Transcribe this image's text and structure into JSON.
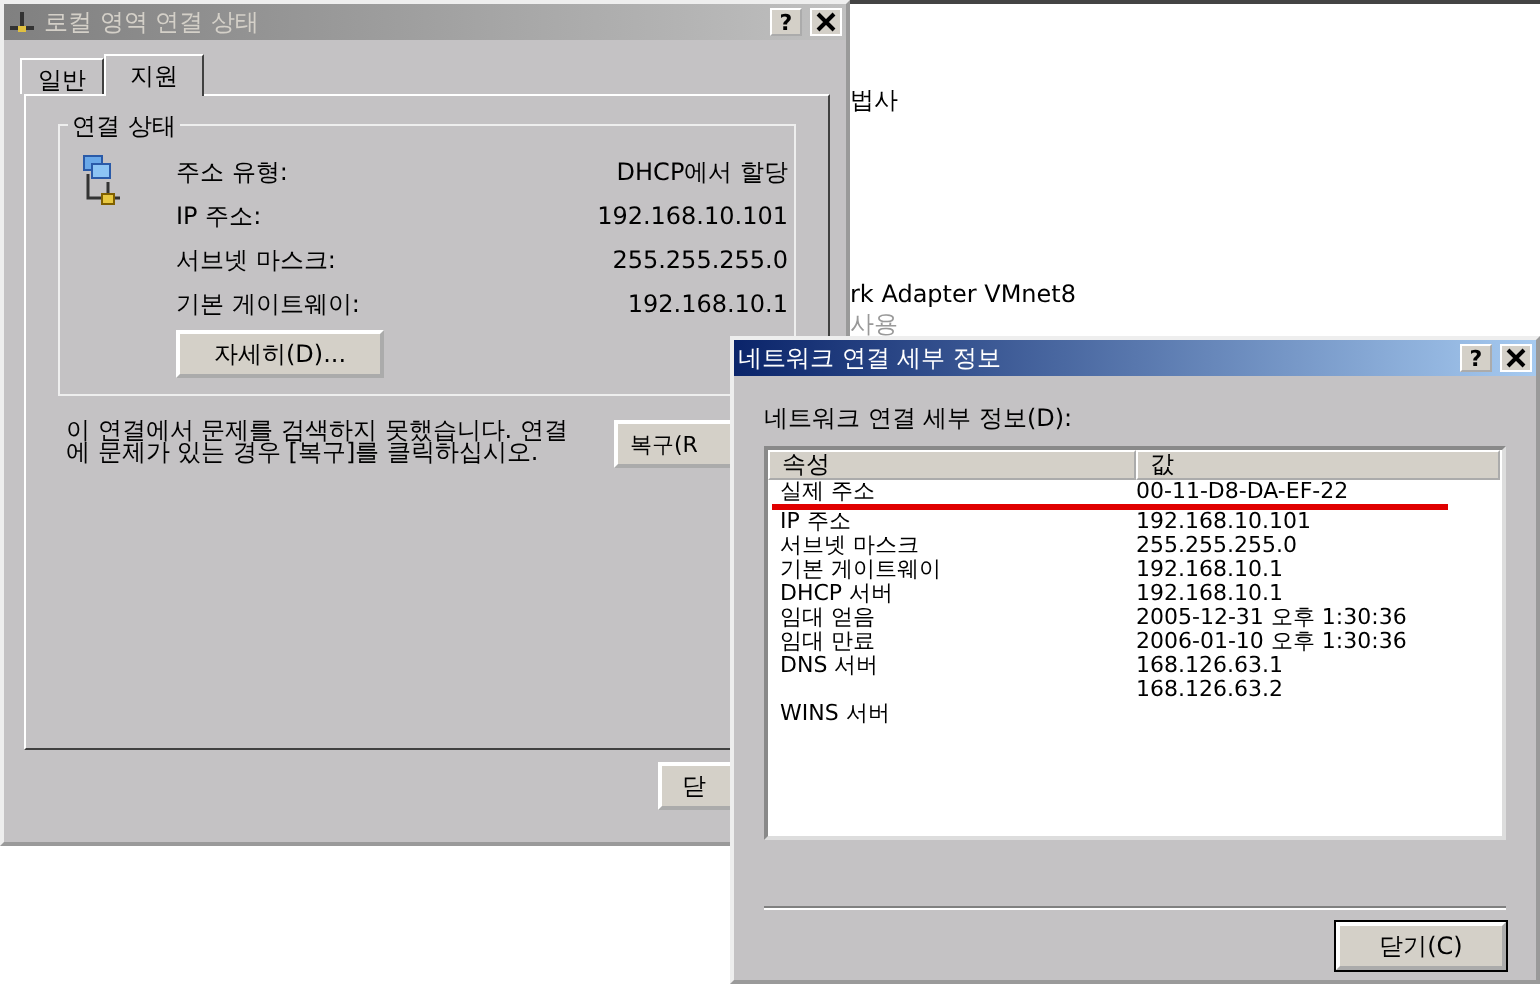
{
  "background_window": {
    "texts": [
      {
        "text": "법사",
        "disabled": false
      },
      {
        "text": "rk Adapter VMnet8",
        "disabled": false
      },
      {
        "text": "사용",
        "disabled": true
      }
    ]
  },
  "status_window": {
    "title": "로컬 영역 연결 상태",
    "active": false,
    "help_button": "?",
    "tabs": [
      {
        "label": "일반",
        "selected": false
      },
      {
        "label": "지원",
        "selected": true
      }
    ],
    "group_title": "연결 상태",
    "fields": [
      {
        "label": "주소 유형:",
        "value": "DHCP에서 할당"
      },
      {
        "label": "IP 주소:",
        "value": "192.168.10.101"
      },
      {
        "label": "서브넷 마스크:",
        "value": "255.255.255.0"
      },
      {
        "label": "기본 게이트웨이:",
        "value": "192.168.10.1"
      }
    ],
    "details_button": "자세히(D)...",
    "message": "이 연결에서 문제를 검색하지 못했습니다. 연결에 문제가 있는 경우 [복구]를 클릭하십시오.",
    "repair_button": "복구(R",
    "close_button": "닫"
  },
  "details_window": {
    "title": "네트워크 연결 세부 정보",
    "active": true,
    "help_button": "?",
    "list_label": "네트워크 연결 세부 정보(D):",
    "columns": [
      "속성",
      "값"
    ],
    "rows": [
      {
        "property": "실제 주소",
        "value": "00-11-D8-DA-EF-22"
      },
      {
        "property": "IP 주소",
        "value": "192.168.10.101"
      },
      {
        "property": "서브넷 마스크",
        "value": "255.255.255.0"
      },
      {
        "property": "기본 게이트웨이",
        "value": "192.168.10.1"
      },
      {
        "property": "DHCP 서버",
        "value": "192.168.10.1"
      },
      {
        "property": "임대 얻음",
        "value": "2005-12-31 오후 1:30:36"
      },
      {
        "property": "임대 만료",
        "value": "2006-01-10 오후 1:30:36"
      },
      {
        "property": "DNS 서버",
        "value": "168.126.63.1"
      },
      {
        "value": "168.126.63.2"
      },
      {
        "property": "WINS 서버"
      }
    ],
    "close_button": "닫기(C)"
  }
}
